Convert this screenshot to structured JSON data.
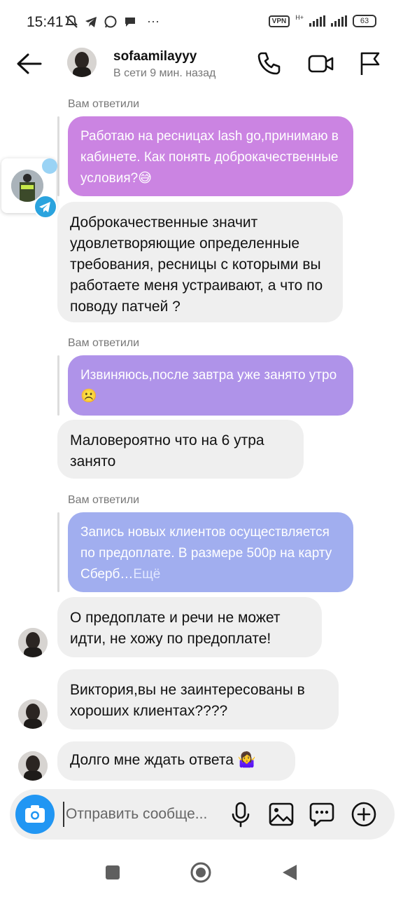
{
  "status_bar": {
    "time": "15:41",
    "vpn": "VPN",
    "network": "H+",
    "battery": "63"
  },
  "header": {
    "username": "sofaamilayyy",
    "status": "В сети 9 мин. назад",
    "icons": [
      "back-arrow-icon",
      "phone-icon",
      "video-camera-icon",
      "flag-icon"
    ]
  },
  "messages": {
    "reply1": {
      "label": "Вам ответили",
      "quoted": "Работаю на ресницах lash go,принимаю в кабинете. Как понять доброкачественные условия?😅",
      "reply": "Доброкачественные значит удовлетворяющие определенные требования, ресницы с которыми вы работаете меня устраивают, а что по поводу патчей ?"
    },
    "reply2": {
      "label": "Вам ответили",
      "quoted": "Извиняюсь,после завтра уже занято утро☹️",
      "reply": "Маловероятно что на 6 утра занято"
    },
    "reply3": {
      "label": "Вам ответили",
      "quoted": "Запись новых клиентов осуществляется  по предоплате. В размере 500р на карту Сберб…",
      "more": "Ещё",
      "reply": "О предоплате и речи не может идти, не хожу по предоплате!"
    },
    "msg4": "Виктория,вы не заинтересованы в хороших клиентах????",
    "msg5": "Долго мне ждать ответа 🤷‍♀️"
  },
  "composer": {
    "placeholder": "Отправить сообще..."
  },
  "colors": {
    "bubble1": "#c77ae0",
    "bubble2": "#a98ae8",
    "bubble3": "#9aa8ee",
    "camera": "#2196f3"
  }
}
